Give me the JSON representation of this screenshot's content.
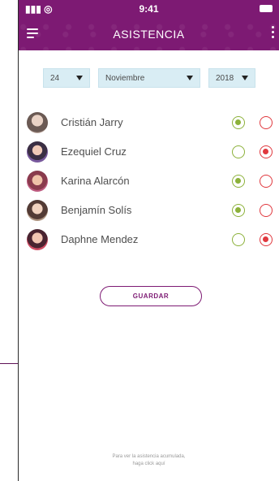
{
  "status": {
    "signal": "▮▮▮ ◎",
    "time": "9:41"
  },
  "header": {
    "title": "ASISTENCIA",
    "menu_icon": "hamburger-menu-icon",
    "more_icon": "vertical-dots-icon"
  },
  "date": {
    "day": "24",
    "month": "Noviembre",
    "year": "2018"
  },
  "students": [
    {
      "name": "Cristián Jarry",
      "present": true,
      "absent": false
    },
    {
      "name": "Ezequiel Cruz",
      "present": false,
      "absent": true
    },
    {
      "name": "Karina Alarcón",
      "present": true,
      "absent": false
    },
    {
      "name": "Benjamín Solís",
      "present": true,
      "absent": false
    },
    {
      "name": "Daphne Mendez",
      "present": false,
      "absent": true
    }
  ],
  "actions": {
    "save_label": "GUARDAR"
  },
  "footer": {
    "line1": "Para ver la asistencia acumulada,",
    "line2": "haga click aquí"
  },
  "colors": {
    "brand": "#7d1a73",
    "present": "#8cb13a",
    "absent": "#e0383e"
  }
}
